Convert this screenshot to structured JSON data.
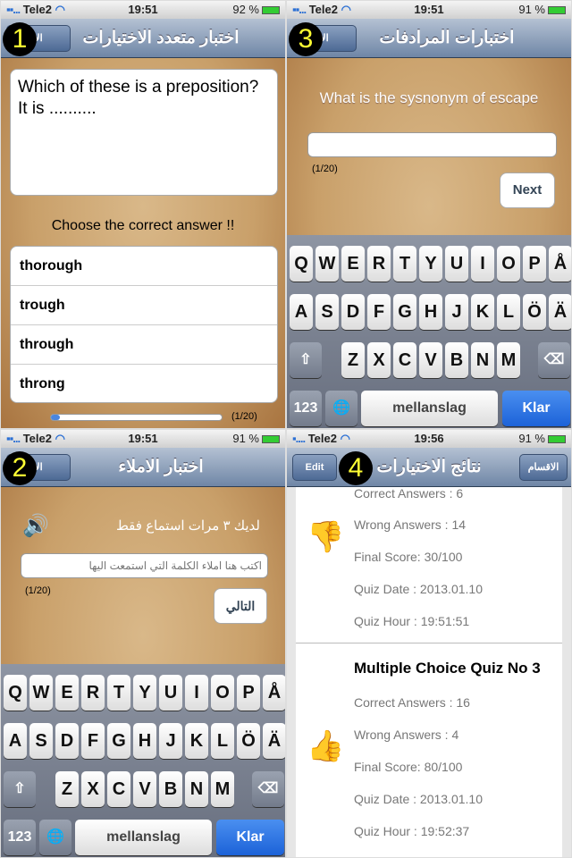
{
  "screens": {
    "mc": {
      "badge": "1",
      "carrier": "Tele2",
      "time": "19:51",
      "battery": "92 %",
      "title": "اختبار متعدد الاختيارات",
      "back": "الا",
      "question": "Which of these is a preposition? It is ..........",
      "instruction": "Choose the correct answer !!",
      "answers": [
        "thorough",
        "trough",
        "through",
        "throng"
      ],
      "progress_label": "(1/20)",
      "progress_fraction": 0.05
    },
    "syn": {
      "badge": "3",
      "carrier": "Tele2",
      "time": "19:51",
      "battery": "91 %",
      "title": "اختبارات المرادفات",
      "back": "الا",
      "question": "What is the sysnonym of escape",
      "input_value": "",
      "counter": "(1/20)",
      "next": "Next"
    },
    "dict": {
      "badge": "2",
      "carrier": "Tele2",
      "time": "19:51",
      "battery": "91 %",
      "title": "اختبار الاملاء",
      "back": "الا",
      "listen_info": "لديك ٣ مرات استماع فقط",
      "placeholder": "اكتب هنا املاء الكلمة التي استمعت اليها",
      "counter": "(1/20)",
      "next": "التالي"
    },
    "results": {
      "badge": "4",
      "carrier": "Tele2",
      "time": "19:56",
      "battery": "91 %",
      "title": "نتائج الاختيارات",
      "edit": "Edit",
      "sections": "الاقسام",
      "items": [
        {
          "title": "",
          "correct": "Correct Answers : 6",
          "wrong": "Wrong Answers : 14",
          "score": "Final Score: 30/100",
          "date": "Quiz Date : 2013.01.10",
          "hour": "Quiz Hour : 19:51:51",
          "icon": "thumbs-down-icon",
          "color": "#d22"
        },
        {
          "title": "Multiple Choice Quiz No 3",
          "correct": "Correct Answers : 16",
          "wrong": "Wrong Answers : 4",
          "score": "Final Score: 80/100",
          "date": "Quiz Date : 2013.01.10",
          "hour": "Quiz Hour : 19:52:37",
          "icon": "thumbs-up-icon",
          "color": "#2a2"
        }
      ]
    }
  },
  "keyboard": {
    "row1": [
      "Q",
      "W",
      "E",
      "R",
      "T",
      "Y",
      "U",
      "I",
      "O",
      "P",
      "Å"
    ],
    "row2": [
      "A",
      "S",
      "D",
      "F",
      "G",
      "H",
      "J",
      "K",
      "L",
      "Ö",
      "Ä"
    ],
    "row3": [
      "Z",
      "X",
      "C",
      "V",
      "B",
      "N",
      "M"
    ],
    "numbers": "123",
    "space": "mellanslag",
    "return": "Klar"
  }
}
